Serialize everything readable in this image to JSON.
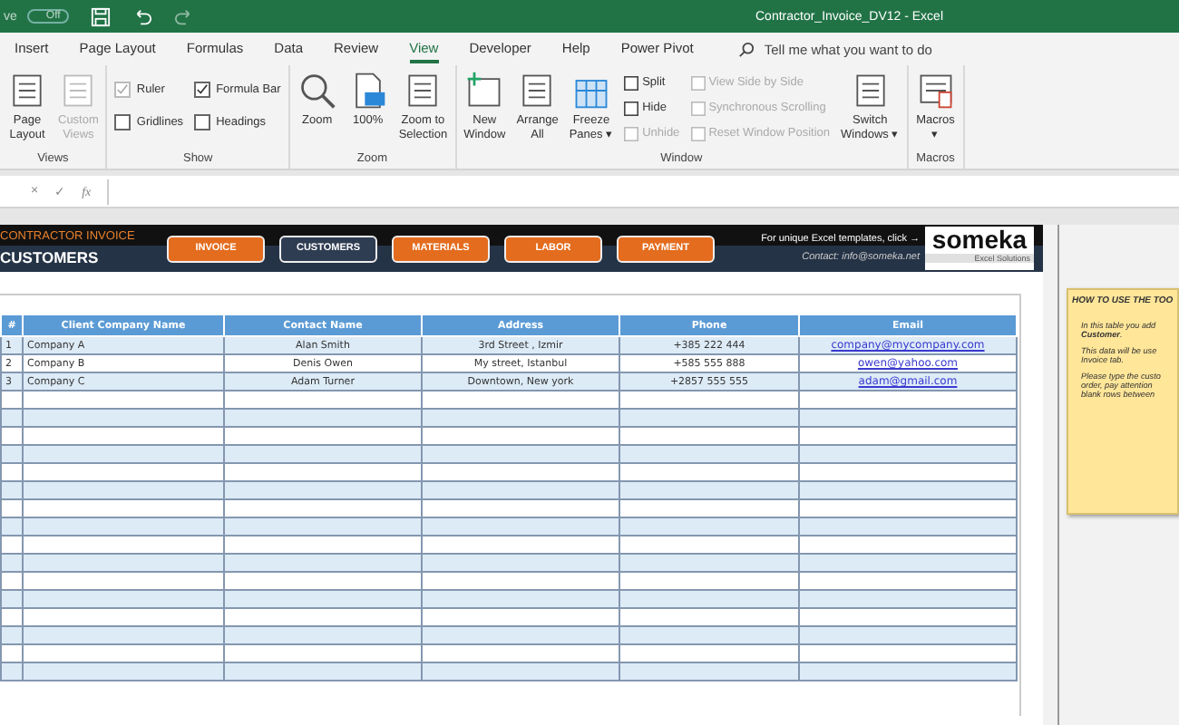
{
  "title_bar": {
    "autosave_prefix": "ve",
    "autosave_state": "Off",
    "title": "Contractor_Invoice_DV12  -  Excel"
  },
  "tabs": [
    {
      "label": "Insert",
      "selected": false
    },
    {
      "label": "Page Layout",
      "selected": false
    },
    {
      "label": "Formulas",
      "selected": false
    },
    {
      "label": "Data",
      "selected": false
    },
    {
      "label": "Review",
      "selected": false
    },
    {
      "label": "View",
      "selected": true
    },
    {
      "label": "Developer",
      "selected": false
    },
    {
      "label": "Help",
      "selected": false
    },
    {
      "label": "Power Pivot",
      "selected": false
    }
  ],
  "tell_me": {
    "placeholder": "Tell me what you want to do"
  },
  "ribbon": [
    {
      "group": "Views",
      "items": [
        {
          "kind": "big",
          "label": "Page\nLayout",
          "disabled": false
        },
        {
          "kind": "big",
          "label": "Custom\nViews",
          "disabled": true
        }
      ]
    },
    {
      "group": "Show",
      "items": [
        {
          "kind": "check",
          "label": "Ruler",
          "checked": true,
          "disabled": true
        },
        {
          "kind": "check",
          "label": "Gridlines",
          "checked": false,
          "disabled": false
        },
        {
          "kind": "check",
          "label": "Formula Bar",
          "checked": true,
          "disabled": false
        },
        {
          "kind": "check",
          "label": "Headings",
          "checked": false,
          "disabled": false
        }
      ]
    },
    {
      "group": "Zoom",
      "items": [
        {
          "kind": "big",
          "label": "Zoom",
          "disabled": false
        },
        {
          "kind": "big",
          "label": "100%",
          "disabled": false
        },
        {
          "kind": "big",
          "label": "Zoom to\nSelection",
          "disabled": false
        }
      ]
    },
    {
      "group": "Window",
      "items": [
        {
          "kind": "big",
          "label": "New\nWindow",
          "disabled": false
        },
        {
          "kind": "big",
          "label": "Arrange\nAll",
          "disabled": false
        },
        {
          "kind": "big",
          "label": "Freeze\nPanes ▾",
          "disabled": false
        },
        {
          "kind": "small",
          "label": "Split",
          "disabled": false
        },
        {
          "kind": "small",
          "label": "Hide",
          "disabled": false
        },
        {
          "kind": "small",
          "label": "Unhide",
          "disabled": true
        },
        {
          "kind": "small",
          "label": "View Side by Side",
          "disabled": true
        },
        {
          "kind": "small",
          "label": "Synchronous Scrolling",
          "disabled": true
        },
        {
          "kind": "small",
          "label": "Reset Window Position",
          "disabled": true
        },
        {
          "kind": "big",
          "label": "Switch\nWindows ▾",
          "disabled": false
        }
      ]
    },
    {
      "group": "Macros",
      "items": [
        {
          "kind": "big",
          "label": "Macros\n▾",
          "disabled": false
        }
      ]
    }
  ],
  "formula_bar": {
    "cancel": "×",
    "enter": "✓",
    "fx": "fx"
  },
  "banner": {
    "subtitle": "CONTRACTOR INVOICE",
    "title": "CUSTOMERS",
    "promo": "For unique Excel templates, click →",
    "contact": "Contact: info@someka.net",
    "logo": "someka",
    "logo_tagline": "Excel Solutions"
  },
  "nav_buttons": [
    {
      "label": "INVOICE",
      "selected": false
    },
    {
      "label": "CUSTOMERS",
      "selected": true
    },
    {
      "label": "MATERIALS",
      "selected": false
    },
    {
      "label": "LABOR",
      "selected": false
    },
    {
      "label": "PAYMENT",
      "selected": false
    }
  ],
  "table": {
    "columns": [
      "#",
      "Client Company Name",
      "Contact Name",
      "Address",
      "Phone",
      "Email"
    ],
    "rows": [
      [
        "1",
        "Company A",
        "Alan Smith",
        "3rd Street , Izmir",
        "+385 222 444",
        "company@mycompany.com"
      ],
      [
        "2",
        "Company B",
        "Denis Owen",
        "My street, Istanbul",
        "+585 555 888",
        "owen@yahoo.com"
      ],
      [
        "3",
        "Company C",
        "Adam Turner",
        "Downtown, New york",
        "+2857 555 555",
        "adam@gmail.com"
      ]
    ]
  },
  "note": {
    "title": "HOW TO USE THE TOO",
    "bullets": [
      [
        "In this table you add",
        "**Customer**."
      ],
      [
        "This data will be use",
        "Invoice tab."
      ],
      [
        "Please type the custo",
        "order, pay attention",
        "blank rows between"
      ]
    ]
  }
}
